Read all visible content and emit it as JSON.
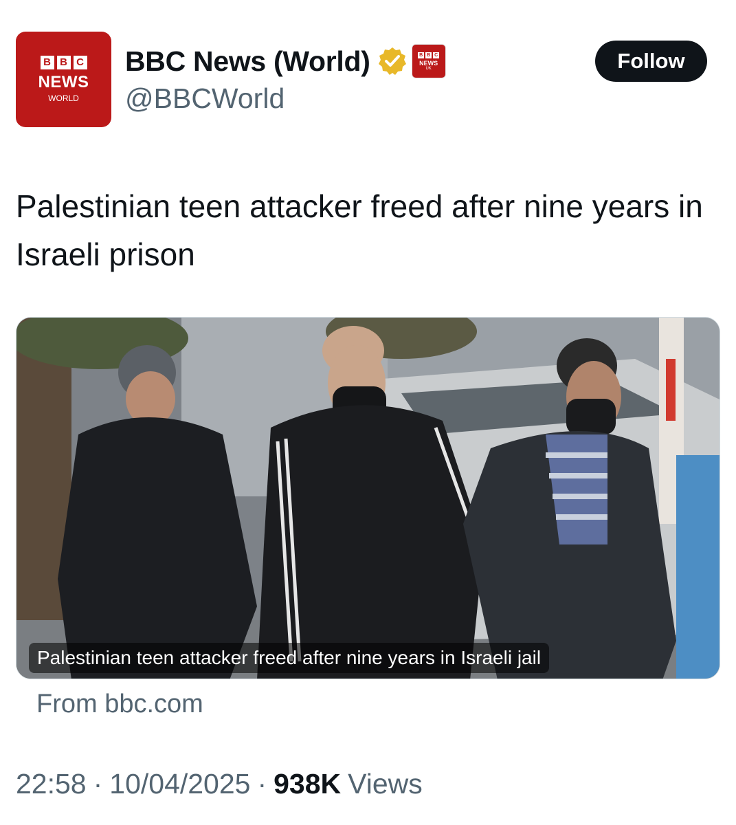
{
  "account": {
    "display_name": "BBC News (World)",
    "handle": "@BBCWorld",
    "avatar_logo": {
      "blocks": [
        "B",
        "B",
        "C"
      ],
      "line1": "NEWS",
      "line2": "WORLD"
    },
    "affiliate_badge": {
      "blocks": [
        "B",
        "B",
        "C"
      ],
      "line1": "NEWS",
      "line2": "UK"
    },
    "verified_badge_icon": "gold-verified-checkmark-icon"
  },
  "follow_button": {
    "label": "Follow"
  },
  "tweet": {
    "text": "Palestinian teen attacker freed after nine years in Israeli prison"
  },
  "link_card": {
    "image_caption": "Palestinian teen attacker freed after nine years in Israeli jail",
    "source_label": "From bbc.com"
  },
  "meta": {
    "time": "22:58",
    "date": "10/04/2025",
    "separator": "·",
    "views_count": "938K",
    "views_label": "Views"
  },
  "colors": {
    "bbc_red": "#bb1919",
    "text_primary": "#0f1419",
    "text_secondary": "#536471",
    "verified_gold": "#e8b829"
  }
}
